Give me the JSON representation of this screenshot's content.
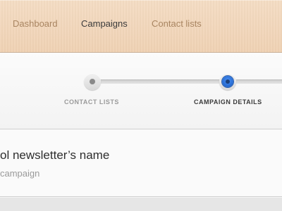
{
  "nav": {
    "items": [
      {
        "label": "Dashboard",
        "active": false
      },
      {
        "label": "Campaigns",
        "active": true
      },
      {
        "label": "Contact lists",
        "active": false
      }
    ]
  },
  "wizard": {
    "steps": [
      {
        "label": "CONTACT LISTS",
        "active": false
      },
      {
        "label": "CAMPAIGN DETAILS",
        "active": true
      }
    ]
  },
  "content": {
    "title": "ol newsletter’s name",
    "subtitle": "campaign"
  },
  "colors": {
    "nav_bg": "#efd1b3",
    "nav_text": "#a98561",
    "active_text": "#3b3b3b",
    "step_active": "#2a6fd6"
  }
}
